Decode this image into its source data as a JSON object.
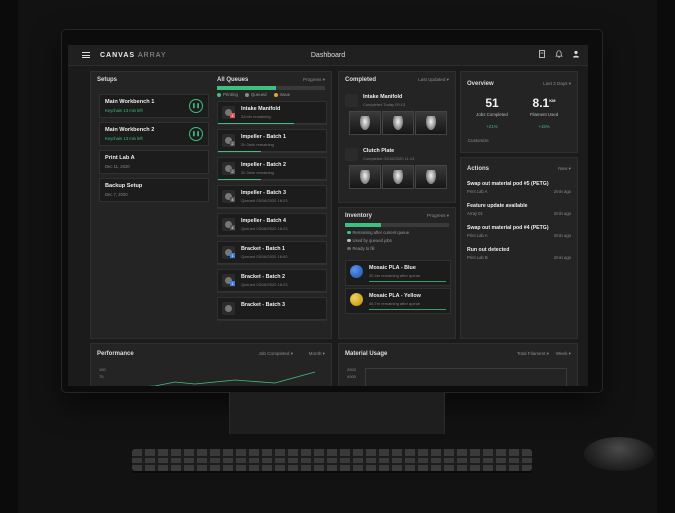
{
  "app": {
    "brand_main": "CANVAS",
    "brand_sub": "ARRAY",
    "page_title": "Dashboard"
  },
  "setups": {
    "title": "Setups",
    "items": [
      {
        "title": "Main Workbench 1",
        "sub": "Keychain  13 min left",
        "active": true
      },
      {
        "title": "Main Workbench 2",
        "sub": "Keychain  13 min left",
        "active": true
      },
      {
        "title": "Print Lab A",
        "sub": "Dec 11, 2020",
        "active": false
      },
      {
        "title": "Backup Setup",
        "sub": "Dec 7, 2020",
        "active": false
      }
    ]
  },
  "queues": {
    "title": "All Queues",
    "filter": "Progress ▾",
    "progress": 0.55,
    "legend": [
      {
        "label": "Printing",
        "color": "#3fbf7f"
      },
      {
        "label": "Queued",
        "color": "#8a8a8a"
      },
      {
        "label": "Issue",
        "color": "#e6a23c"
      }
    ],
    "items": [
      {
        "title": "Intake Manifold",
        "sub": "32min remaining",
        "badge": "4",
        "badge_color": "#d9534f",
        "progress": 0.7
      },
      {
        "title": "Impeller - Batch 1",
        "sub": "2h 3min remaining",
        "badge": "2",
        "badge_color": "#555555",
        "progress": 0.4
      },
      {
        "title": "Impeller - Batch 2",
        "sub": "2h 3min remaining",
        "badge": "2",
        "badge_color": "#555555",
        "progress": 0.4
      },
      {
        "title": "Impeller - Batch 3",
        "sub": "Queued 03/16/2020 16:23",
        "badge": "4",
        "badge_color": "#555555",
        "progress": 0
      },
      {
        "title": "Impeller - Batch 4",
        "sub": "Queued 03/16/2020 16:23",
        "badge": "4",
        "badge_color": "#555555",
        "progress": 0
      },
      {
        "title": "Bracket - Batch 1",
        "sub": "Queued 03/16/2020 16:00",
        "badge": "1",
        "badge_color": "#3d7bd9",
        "progress": 0
      },
      {
        "title": "Bracket - Batch 2",
        "sub": "Queued 03/16/2020 16:23",
        "badge": "1",
        "badge_color": "#3d7bd9",
        "progress": 0
      },
      {
        "title": "Bracket - Batch 3",
        "sub": "",
        "badge": "",
        "badge_color": "#555555",
        "progress": 0
      }
    ]
  },
  "completed": {
    "title": "Completed",
    "filter": "Last Updated ▾",
    "items": [
      {
        "title": "Intake Manifold",
        "sub": "Completed Today 09:13"
      },
      {
        "title": "Clutch Plate",
        "sub": "Completed 03/16/2020 11:13"
      }
    ]
  },
  "inventory": {
    "title": "Inventory",
    "filter": "Progress ▾",
    "progress": 0.35,
    "legend": [
      {
        "label": "Remaining after current queue",
        "color": "#3fbf7f"
      },
      {
        "label": "Used by queued jobs",
        "color": "#bbbbbb"
      },
      {
        "label": "Ready to fill",
        "color": "#666666"
      }
    ],
    "items": [
      {
        "title": "Mosaic PLA - Blue",
        "sub": "30.4m remaining after queue",
        "color": "#2e6cd1",
        "badge": "4"
      },
      {
        "title": "Mosaic PLA - Yellow",
        "sub": "46.7m remaining after queue",
        "color": "#e2b92c",
        "badge": "8"
      }
    ]
  },
  "overview": {
    "title": "Overview",
    "filter": "Last 3 Days ▾",
    "jobs": {
      "value": "51",
      "label": "Jobs Completed",
      "change": "+21%"
    },
    "filament": {
      "value": "8.1",
      "unit": "KM",
      "label": "Filament Used",
      "change": "+15%"
    },
    "customize": "Customize"
  },
  "actions": {
    "title": "Actions",
    "filter": "New ▾",
    "items": [
      {
        "title": "Swap out material pod #5 (PETG)",
        "sub": "Print Lab A",
        "time": "2min ago"
      },
      {
        "title": "Feature update available",
        "sub": "Array 01",
        "time": "2min ago"
      },
      {
        "title": "Swap out material pod #4 (PETG)",
        "sub": "Print Lab A",
        "time": "2min ago"
      },
      {
        "title": "Run out detected",
        "sub": "Print Lab B",
        "time": "2min ago"
      }
    ]
  },
  "performance": {
    "title": "Performance",
    "filter1": "Job Completed ▾",
    "filter2": "Month ▾",
    "y_ticks": [
      "100",
      "75"
    ]
  },
  "material_usage": {
    "title": "Material Usage",
    "filter1": "Total Filament ▾",
    "filter2": "Week ▾",
    "y_ticks": [
      "2000",
      "4000"
    ]
  }
}
